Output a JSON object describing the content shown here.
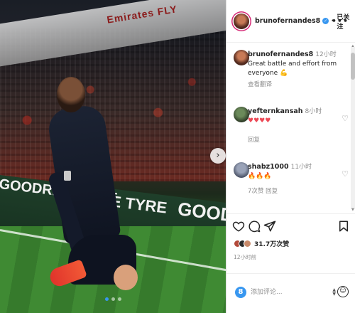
{
  "photo": {
    "roof_text": "Emirates FLY",
    "ad_text_left": "GOODRIDE TYRE",
    "ad_text_mid": "DE TYRE",
    "ad_text_right": "GOODR",
    "next_icon": "chevron-right-icon",
    "carousel_dots": 3,
    "carousel_active": 0
  },
  "header": {
    "username": "brunofernandes8",
    "separator": "•",
    "follow_status": "已关注",
    "more_icon": "more-horizontal-icon"
  },
  "comments": [
    {
      "username": "brunofernandes8",
      "time": "12小时",
      "text": "Great battle and effort from everyone 💪",
      "action": "查看翻译"
    },
    {
      "username": "yefternkansah",
      "time": "8小时",
      "text": "♥♥♥♥",
      "action": "回复"
    },
    {
      "username": "shabz1000",
      "time": "11小时",
      "text": "🔥🔥🔥",
      "action": "7次赞    回复"
    }
  ],
  "likes": {
    "text": "31.7万次赞"
  },
  "post_time": "12小时前",
  "add_comment": {
    "placeholder": "添加评论..."
  },
  "colors": {
    "accent": "#3897f0",
    "heart": "#ed4956",
    "story_ring": "#d62976"
  }
}
